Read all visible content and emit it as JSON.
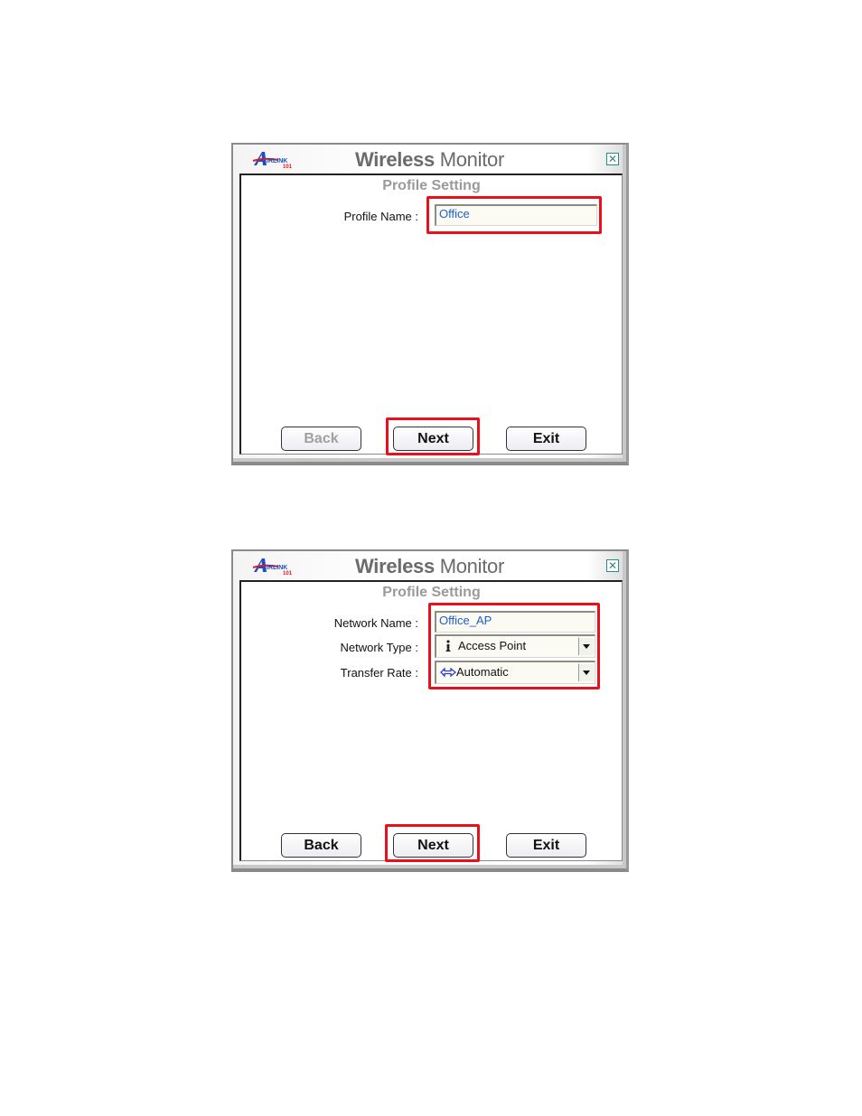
{
  "dialogs": [
    {
      "app_title_bold": "Wireless",
      "app_title_light": "Monitor",
      "logo_text": "AirLink 101",
      "close_icon": "close-icon",
      "section_title": "Profile Setting",
      "fields": [
        {
          "label": "Profile Name :",
          "value": "Office"
        }
      ],
      "buttons": {
        "back": "Back",
        "next": "Next",
        "exit": "Exit"
      },
      "back_enabled": false,
      "highlights": [
        "profile-name-field",
        "next-button"
      ]
    },
    {
      "app_title_bold": "Wireless",
      "app_title_light": "Monitor",
      "logo_text": "AirLink 101",
      "close_icon": "close-icon",
      "section_title": "Profile Setting",
      "fields": [
        {
          "label": "Network Name :",
          "value": "Office_AP"
        },
        {
          "label": "Network Type :",
          "value": "Access Point",
          "icon": "access-point-icon"
        },
        {
          "label": "Transfer Rate :",
          "value": "Automatic",
          "icon": "double-arrow-icon"
        }
      ],
      "buttons": {
        "back": "Back",
        "next": "Next",
        "exit": "Exit"
      },
      "back_enabled": true,
      "highlights": [
        "network-settings-group",
        "next-button"
      ]
    }
  ],
  "colors": {
    "highlight": "#e8101a",
    "input_text": "#1e5fc8",
    "title_gray": "#6b6b6b",
    "section_gray": "#9a9a9a"
  }
}
